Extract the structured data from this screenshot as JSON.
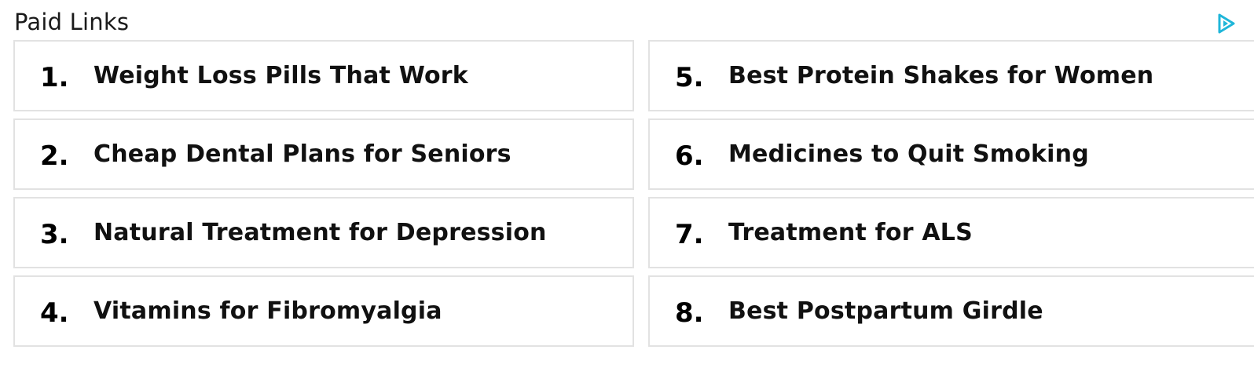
{
  "header": {
    "title": "Paid Links"
  },
  "adchoices": {
    "icon": "adchoices-icon",
    "color": "#1fb6d9"
  },
  "links": [
    {
      "number": "1.",
      "text": "Weight Loss Pills That Work"
    },
    {
      "number": "2.",
      "text": "Cheap Dental Plans for Seniors"
    },
    {
      "number": "3.",
      "text": "Natural Treatment for Depression"
    },
    {
      "number": "4.",
      "text": "Vitamins for Fibromyalgia"
    },
    {
      "number": "5.",
      "text": "Best Protein Shakes for Women"
    },
    {
      "number": "6.",
      "text": "Medicines to Quit Smoking"
    },
    {
      "number": "7.",
      "text": "Treatment for ALS"
    },
    {
      "number": "8.",
      "text": "Best Postpartum Girdle"
    }
  ]
}
